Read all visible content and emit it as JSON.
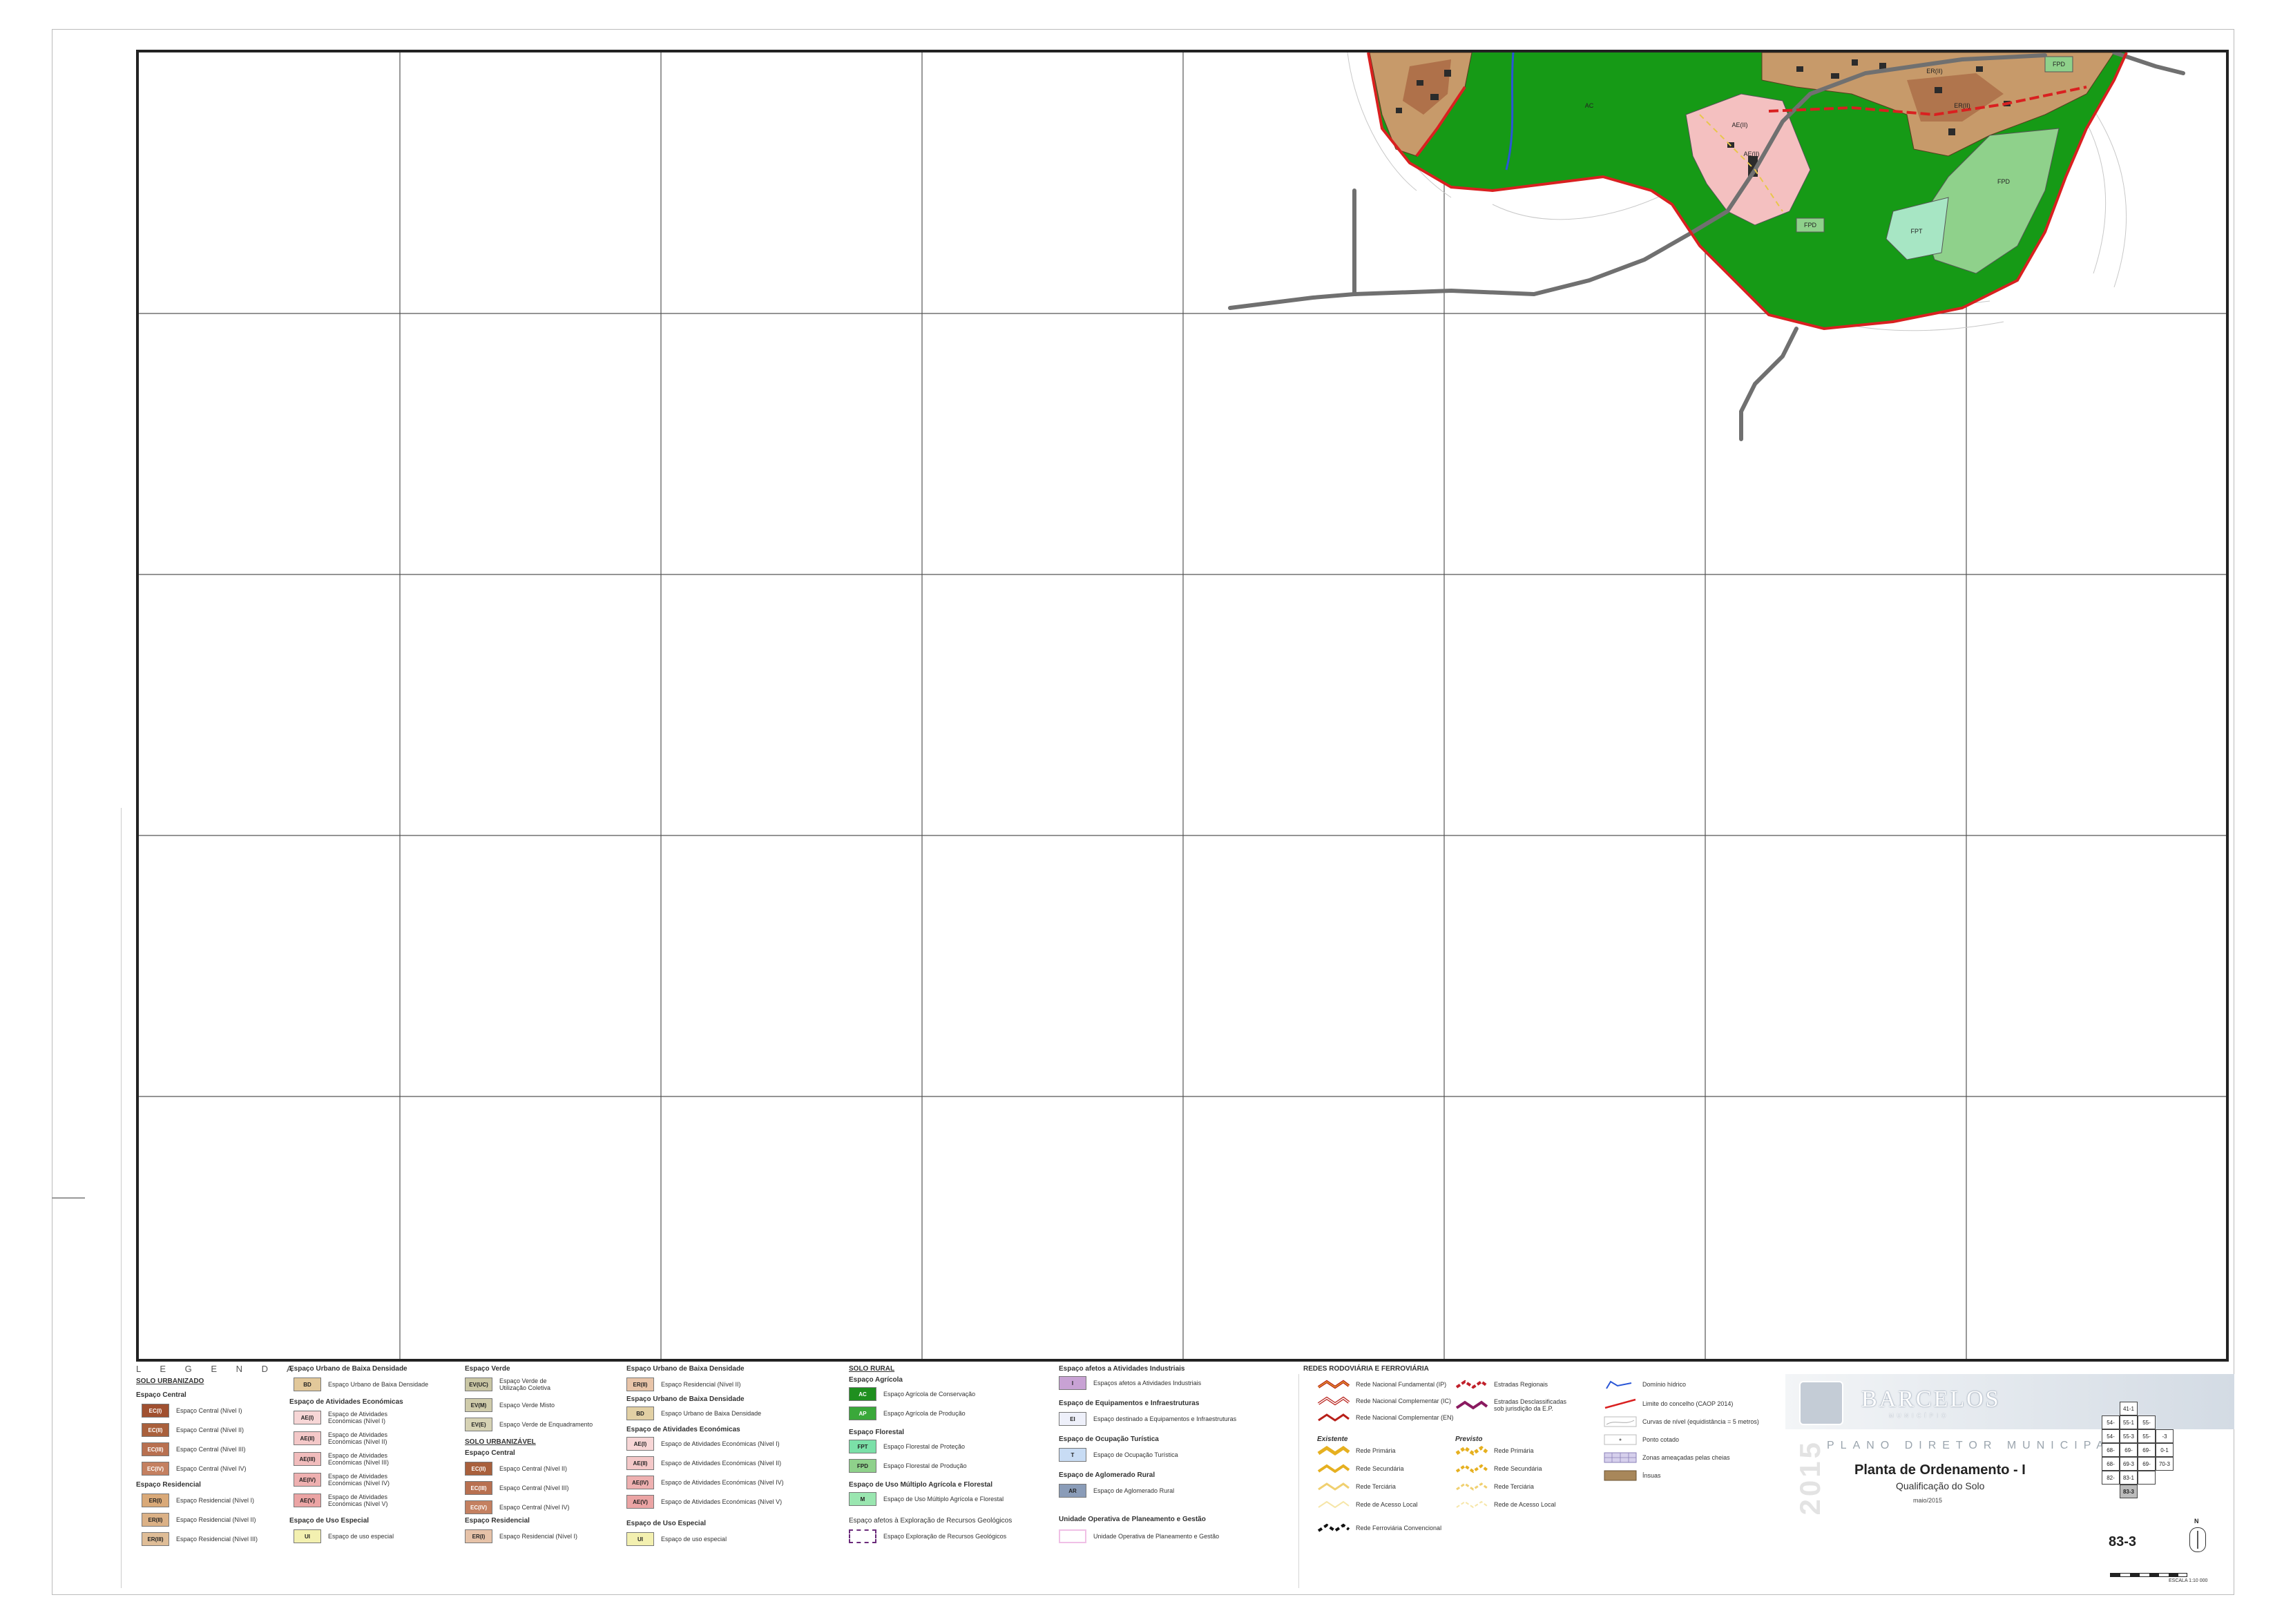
{
  "colors": {
    "forest_green": "#169a16",
    "urban_pink": "#f4c0c0",
    "urban_brown": "#c79a6a",
    "central_dark": "#9a5030",
    "light_green": "#8fd18b",
    "water_blue": "#2a56d6",
    "boundary_red": "#d92020",
    "road_gray": "#707070",
    "contour": "#c8c8c8"
  },
  "map": {
    "zone_labels": [
      "AE(II)",
      "AE(II)",
      "FPD",
      "FPD",
      "FPT",
      "ER(II)",
      "ER(II)",
      "FPD",
      "AC"
    ]
  },
  "legend": {
    "title": "L E G E N D A",
    "col1": {
      "header": "SOLO URBANIZADO",
      "group1": "Espaço Central",
      "items1": [
        {
          "code": "EC(I)",
          "label": "Espaço Central (Nível I)"
        },
        {
          "code": "EC(II)",
          "label": "Espaço Central (Nível II)"
        },
        {
          "code": "EC(III)",
          "label": "Espaço Central (Nível III)"
        },
        {
          "code": "EC(IV)",
          "label": "Espaço Central (Nível IV)"
        }
      ],
      "group2": "Espaço Residencial",
      "items2": [
        {
          "code": "ER(I)",
          "label": "Espaço Residencial (Nível I)"
        },
        {
          "code": "ER(II)",
          "label": "Espaço Residencial (Nível II)"
        },
        {
          "code": "ER(III)",
          "label": "Espaço Residencial (Nível III)"
        }
      ]
    },
    "col2": {
      "group1": "Espaço Urbano de Baixa Densidade",
      "item1": {
        "code": "BD",
        "label": "Espaço Urbano de Baixa Densidade"
      },
      "group2": "Espaço de Atividades Económicas",
      "items2": [
        {
          "code": "AE(I)",
          "label": "Espaço de Atividades Económicas (Nível I)"
        },
        {
          "code": "AE(II)",
          "label": "Espaço de Atividades Económicas (Nível II)"
        },
        {
          "code": "AE(III)",
          "label": "Espaço de Atividades Económicas (Nível III)"
        },
        {
          "code": "AE(IV)",
          "label": "Espaço de Atividades Económicas (Nível IV)"
        },
        {
          "code": "AE(V)",
          "label": "Espaço de Atividades Económicas (Nível V)"
        }
      ],
      "group3": "Espaço de Uso Especial",
      "item3": {
        "code": "UI",
        "label": "Espaço de uso especial"
      }
    },
    "col3": {
      "group1": "Espaço Verde",
      "items1": [
        {
          "code": "EV(UC)",
          "label": "Espaço Verde de Utilização Coletiva"
        },
        {
          "code": "EV(M)",
          "label": "Espaço Verde Misto"
        },
        {
          "code": "EV(E)",
          "label": "Espaço Verde de Enquadramento"
        }
      ],
      "header2": "SOLO URBANIZÁVEL",
      "group2": "Espaço Central",
      "items2": [
        {
          "code": "EC(II)",
          "label": "Espaço Central (Nível II)"
        },
        {
          "code": "EC(III)",
          "label": "Espaço Central (Nível III)"
        },
        {
          "code": "EC(IV)",
          "label": "Espaço Central (Nível IV)"
        }
      ],
      "group3": "Espaço Residencial",
      "item3": {
        "code": "ER(I)",
        "label": "Espaço Residencial (Nível I)"
      }
    },
    "col4": {
      "group1": "Espaço Urbano de Baixa Densidade",
      "item1": {
        "code": "ER(II)",
        "label": "Espaço Residencial (Nível II)"
      },
      "group2": "Espaço Urbano de Baixa Densidade",
      "item2": {
        "code": "BD",
        "label": "Espaço Urbano de Baixa Densidade"
      },
      "group3": "Espaço de Atividades Económicas",
      "items3": [
        {
          "code": "AE(I)",
          "label": "Espaço de Atividades Económicas (Nível I)"
        },
        {
          "code": "AE(II)",
          "label": "Espaço de Atividades Económicas (Nível II)"
        },
        {
          "code": "AE(IV)",
          "label": "Espaço de Atividades Económicas (Nível IV)"
        },
        {
          "code": "AE(V)",
          "label": "Espaço de Atividades Económicas (Nível V)"
        }
      ],
      "group4": "Espaço de Uso Especial",
      "item4": {
        "code": "UI",
        "label": "Espaço de uso especial"
      }
    },
    "col5": {
      "header": "SOLO RURAL",
      "group1": "Espaço Agrícola",
      "items1": [
        {
          "code": "AC",
          "label": "Espaço Agrícola de Conservação"
        },
        {
          "code": "AP",
          "label": "Espaço Agrícola de Produção"
        }
      ],
      "group2": "Espaço Florestal",
      "items2": [
        {
          "code": "FPT",
          "label": "Espaço Florestal de Proteção"
        },
        {
          "code": "FPD",
          "label": "Espaço Florestal de Produção"
        }
      ],
      "group3": "Espaço de Uso Múltiplo Agrícola e Florestal",
      "item3": {
        "code": "M",
        "label": "Espaço de Uso Múltiplo Agrícola e Florestal"
      },
      "group4": "Espaço afetos à Exploração de Recursos Geológicos",
      "item4": {
        "label": "Espaço Exploração de Recursos Geológicos"
      }
    },
    "col6": {
      "group1": "Espaço afetos a Atividades Industriais",
      "item1": {
        "code": "I",
        "label": "Espaços afetos a Atividades Industriais"
      },
      "group2": "Espaço de Equipamentos e Infraestruturas",
      "item2": {
        "code": "EI",
        "label": "Espaço destinado a Equipamentos e Infraestruturas"
      },
      "group3": "Espaço de Ocupação Turística",
      "item3": {
        "code": "T",
        "label": "Espaço de Ocupação Turística"
      },
      "group4": "Espaço de Aglomerado Rural",
      "item4": {
        "code": "AR",
        "label": "Espaço de Aglomerado Rural"
      },
      "group5": "Unidade Operativa de Planeamento e Gestão",
      "item5": {
        "label": "Unidade Operativa de Planeamento e Gestão"
      }
    },
    "col7": {
      "header": "REDES RODOVIÁRIA E FERROVIÁRIA",
      "roads_top": [
        "Rede Nacional Fundamental (IP)",
        "Rede Nacional Complementar (IC)",
        "Rede Nacional Complementar (EN)"
      ],
      "roads_top_right": [
        "Estradas Regionais",
        "Estradas Desclassificadas sob jurisdição da E.P."
      ],
      "existing_label": "Existente",
      "planned_label": "Previsto",
      "existing": [
        "Rede Primária",
        "Rede Secundária",
        "Rede Terciária",
        "Rede de Acesso Local"
      ],
      "planned": [
        "Rede Primária",
        "Rede Secundária",
        "Rede Terciária",
        "Rede de Acesso Local"
      ],
      "rail": "Rede Ferroviária Convencional"
    },
    "col8": {
      "items": [
        "Domínio hídrico",
        "Limite do concelho (CAOP 2014)",
        "Curvas de nível (equidistância = 5 metros)",
        "Ponto cotado",
        "Zonas ameaçadas pelas cheias",
        "Ínsuas"
      ]
    }
  },
  "title_block": {
    "brand": "BARCELOS",
    "brand_sub": "MUNICÍPIO",
    "year": "2015",
    "program": "PLANO DIRETOR MUNICIPAL",
    "title": "Planta de Ordenamento - I",
    "subtitle": "Qualificação do Solo",
    "date": "maio/2015",
    "sheet": "83-3",
    "north": "N",
    "scale": "ESCALA 1:10 000",
    "index": [
      {
        "row": 0,
        "cells": [
          "41-1"
        ]
      },
      {
        "row": 1,
        "cells": [
          "54-",
          "55-1",
          "55-"
        ]
      },
      {
        "row": 2,
        "cells": [
          "54-",
          "55-3",
          "55-",
          "-3"
        ]
      },
      {
        "row": 3,
        "cells": [
          "68-",
          "69-",
          "69-",
          "0-1"
        ]
      },
      {
        "row": 4,
        "cells": [
          "68-",
          "69-3",
          "69-",
          "70-3"
        ]
      },
      {
        "row": 5,
        "cells": [
          "82-",
          "83-1",
          ""
        ]
      },
      {
        "row": 6,
        "cells": [
          "83-3"
        ]
      }
    ]
  }
}
